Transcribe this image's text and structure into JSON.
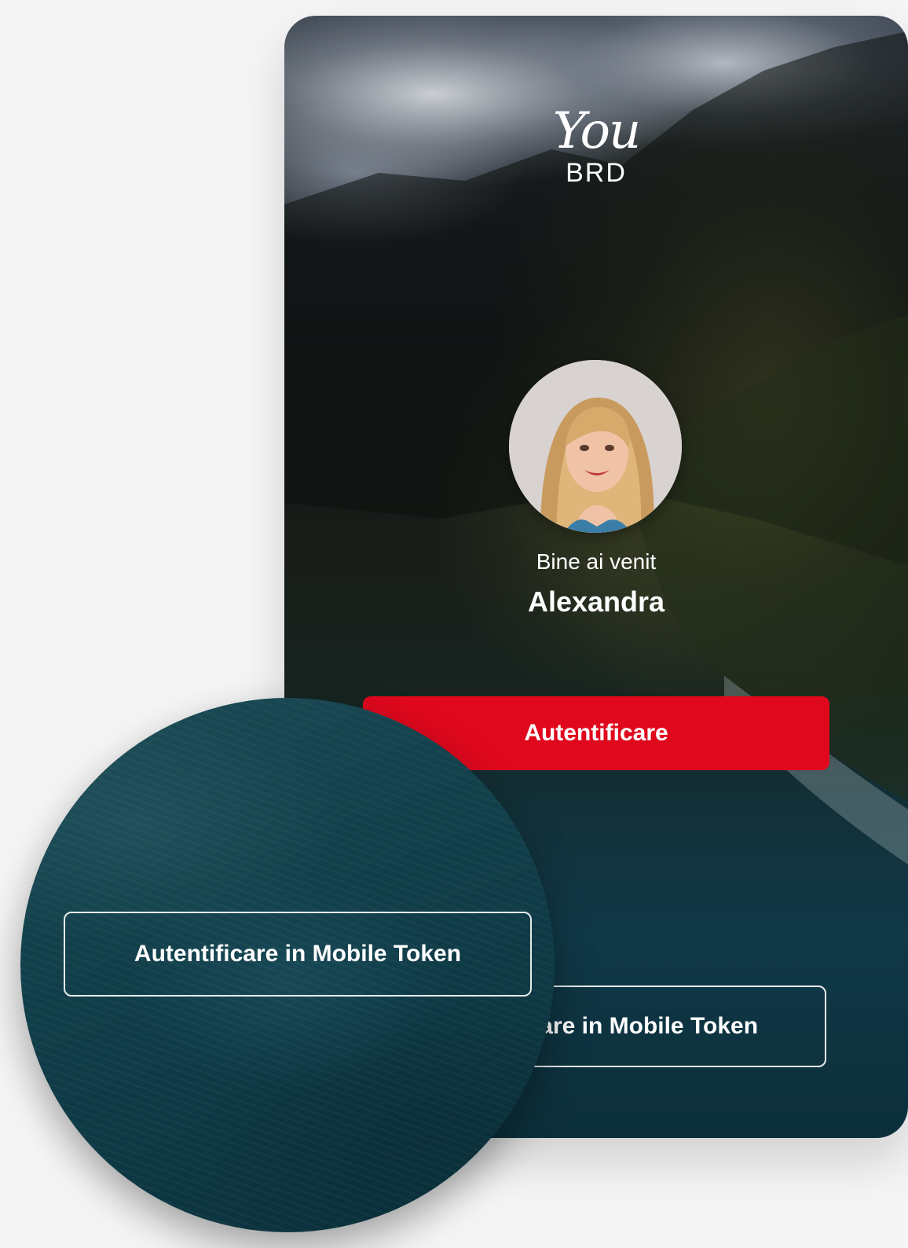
{
  "brand": {
    "logo_top": "You",
    "logo_bottom": "BRD"
  },
  "login": {
    "welcome": "Bine ai venit",
    "username": "Alexandra",
    "primary_button": "Autentificare",
    "token_button": "Autentificare in Mobile Token"
  },
  "zoom_callout": {
    "token_button": "Autentificare in Mobile Token"
  },
  "colors": {
    "accent": "#e0081d",
    "page_bg": "#f5f5f5",
    "text": "#ffffff"
  }
}
